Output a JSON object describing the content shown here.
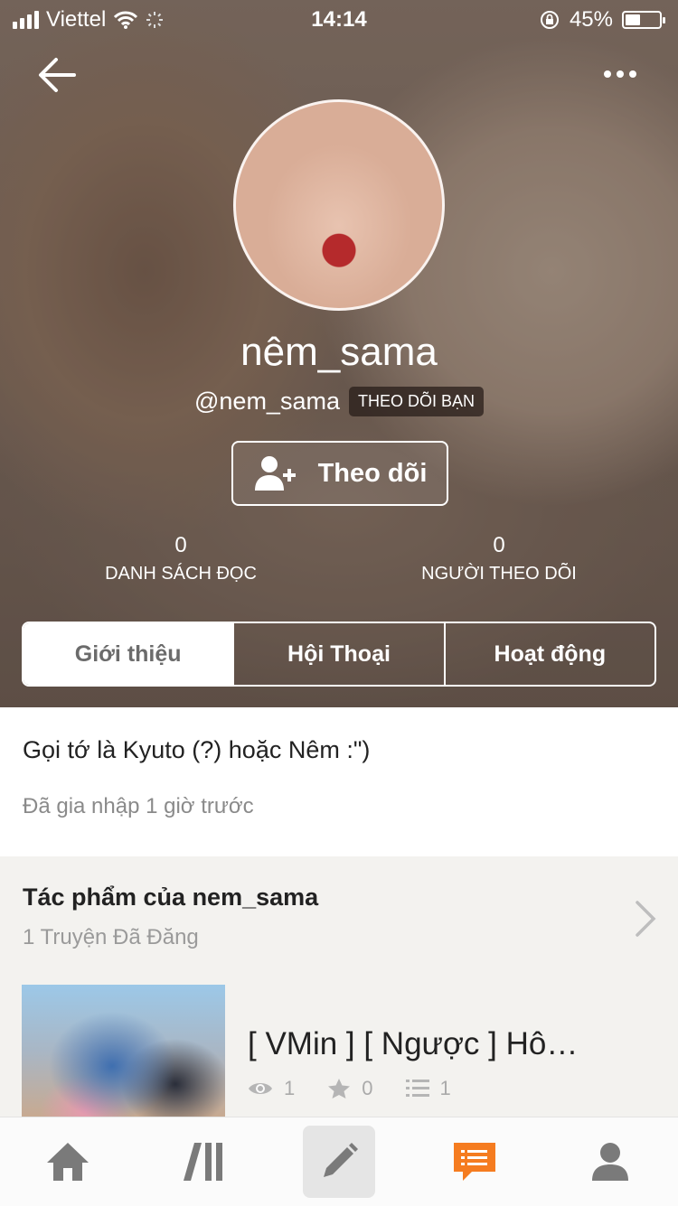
{
  "status_bar": {
    "carrier": "Viettel",
    "time": "14:14",
    "battery": "45%",
    "battery_level": 0.45
  },
  "profile": {
    "display_name": "nêm_sama",
    "handle": "@nem_sama",
    "follows_you_badge": "THEO DÕI BẠN",
    "follow_button_label": "Theo dõi"
  },
  "stats": [
    {
      "value": "0",
      "label": "DANH SÁCH ĐỌC"
    },
    {
      "value": "0",
      "label": "NGƯỜI THEO DÕI"
    }
  ],
  "tabs": [
    {
      "label": "Giới thiệu",
      "active": true
    },
    {
      "label": "Hội Thoại",
      "active": false
    },
    {
      "label": "Hoạt động",
      "active": false
    }
  ],
  "about": {
    "description": "Gọi tớ là Kyuto (?) hoặc Nêm :\")",
    "joined": "Đã gia nhập 1 giờ trước"
  },
  "works": {
    "title": "Tác phẩm của nem_sama",
    "subtitle": "1 Truyện Đã Đăng",
    "stories": [
      {
        "title": "[ VMin ] [ Ngược ] Hô…",
        "reads": "1",
        "votes": "0",
        "parts": "1"
      }
    ]
  },
  "icons": {
    "back": "back-arrow-icon",
    "more": "more-icon",
    "add_user": "add-user-icon",
    "chevron": "chevron-right-icon",
    "nav": [
      "home-icon",
      "library-icon",
      "write-icon",
      "messages-icon",
      "profile-icon"
    ]
  },
  "colors": {
    "accent": "#f57c20",
    "nav_icon": "#7a7a7a"
  }
}
